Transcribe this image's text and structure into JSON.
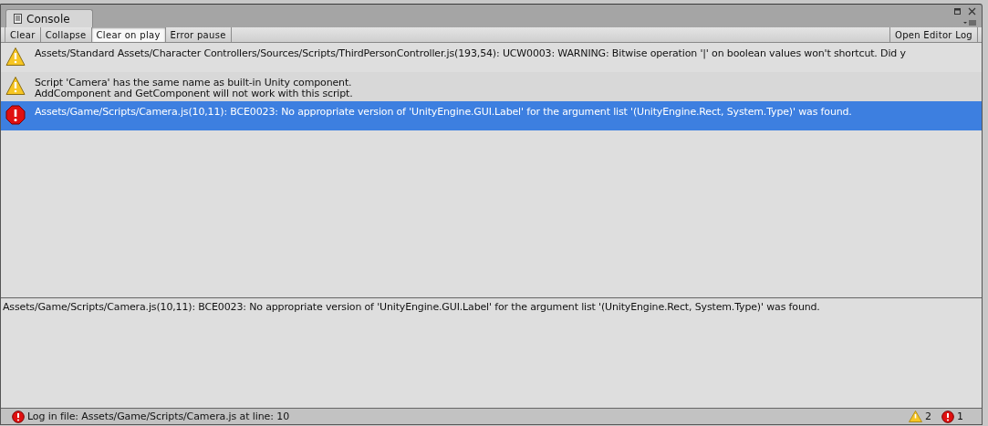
{
  "window": {
    "tab_title": "Console"
  },
  "toolbar": {
    "buttons": [
      {
        "label": "Clear",
        "kind": "button"
      },
      {
        "label": "Collapse",
        "kind": "toggle",
        "on": false
      },
      {
        "label": "Clear on play",
        "kind": "toggle",
        "on": true
      },
      {
        "label": "Error pause",
        "kind": "toggle",
        "on": false
      }
    ],
    "right_button": "Open Editor Log"
  },
  "log": [
    {
      "kind": "warning",
      "selected": false,
      "lines": [
        "Assets/Standard Assets/Character Controllers/Sources/Scripts/ThirdPersonController.js(193,54): UCW0003: WARNING: Bitwise operation '|' on boolean values won't shortcut. Did y"
      ]
    },
    {
      "kind": "warning",
      "selected": false,
      "lines": [
        "Script 'Camera' has the same name as built-in Unity component.",
        "AddComponent and GetComponent will not work with this script."
      ]
    },
    {
      "kind": "error",
      "selected": true,
      "lines": [
        "Assets/Game/Scripts/Camera.js(10,11): BCE0023: No appropriate version of 'UnityEngine.GUI.Label' for the argument list '(UnityEngine.Rect, System.Type)' was found."
      ]
    }
  ],
  "details": "Assets/Game/Scripts/Camera.js(10,11): BCE0023: No appropriate version of 'UnityEngine.GUI.Label' for the argument list '(UnityEngine.Rect, System.Type)' was found.",
  "status_bar": {
    "kind": "error",
    "message": "Log in file: Assets/Game/Scripts/Camera.js at line: 10",
    "warning_count": "2",
    "error_count": "1"
  }
}
